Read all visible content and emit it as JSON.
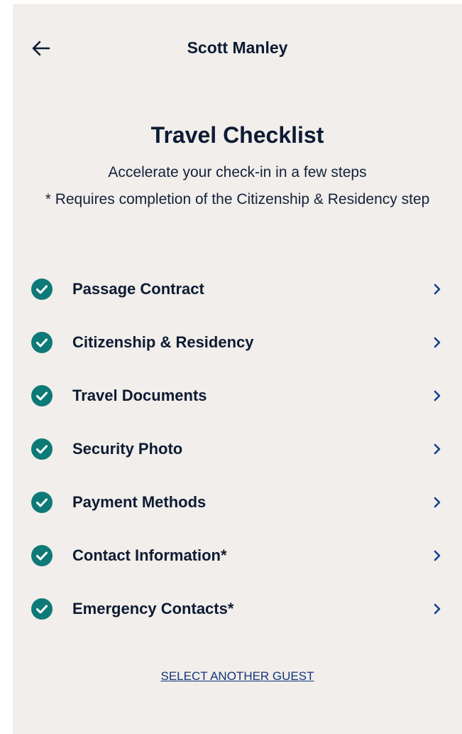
{
  "header": {
    "back_icon": "arrow-left-icon",
    "title": "Scott Manley"
  },
  "intro": {
    "title": "Travel Checklist",
    "subtitle": "Accelerate your check-in in a few steps",
    "note": "* Requires completion of the Citizenship & Residency step"
  },
  "checklist": {
    "status_icon": "check-circle-icon",
    "chevron_icon": "chevron-right-icon",
    "items": [
      {
        "label": "Passage Contract",
        "completed": true
      },
      {
        "label": "Citizenship & Residency",
        "completed": true
      },
      {
        "label": "Travel Documents",
        "completed": true
      },
      {
        "label": "Security Photo",
        "completed": true
      },
      {
        "label": "Payment Methods",
        "completed": true
      },
      {
        "label": "Contact Information*",
        "completed": true
      },
      {
        "label": "Emergency Contacts*",
        "completed": true
      }
    ]
  },
  "footer": {
    "link_label": "SELECT ANOTHER GUEST"
  },
  "colors": {
    "background": "#f1eeeb",
    "check": "#0e7a78",
    "chevron": "#16408f",
    "text": "#0d1b33",
    "link": "#13357a"
  }
}
